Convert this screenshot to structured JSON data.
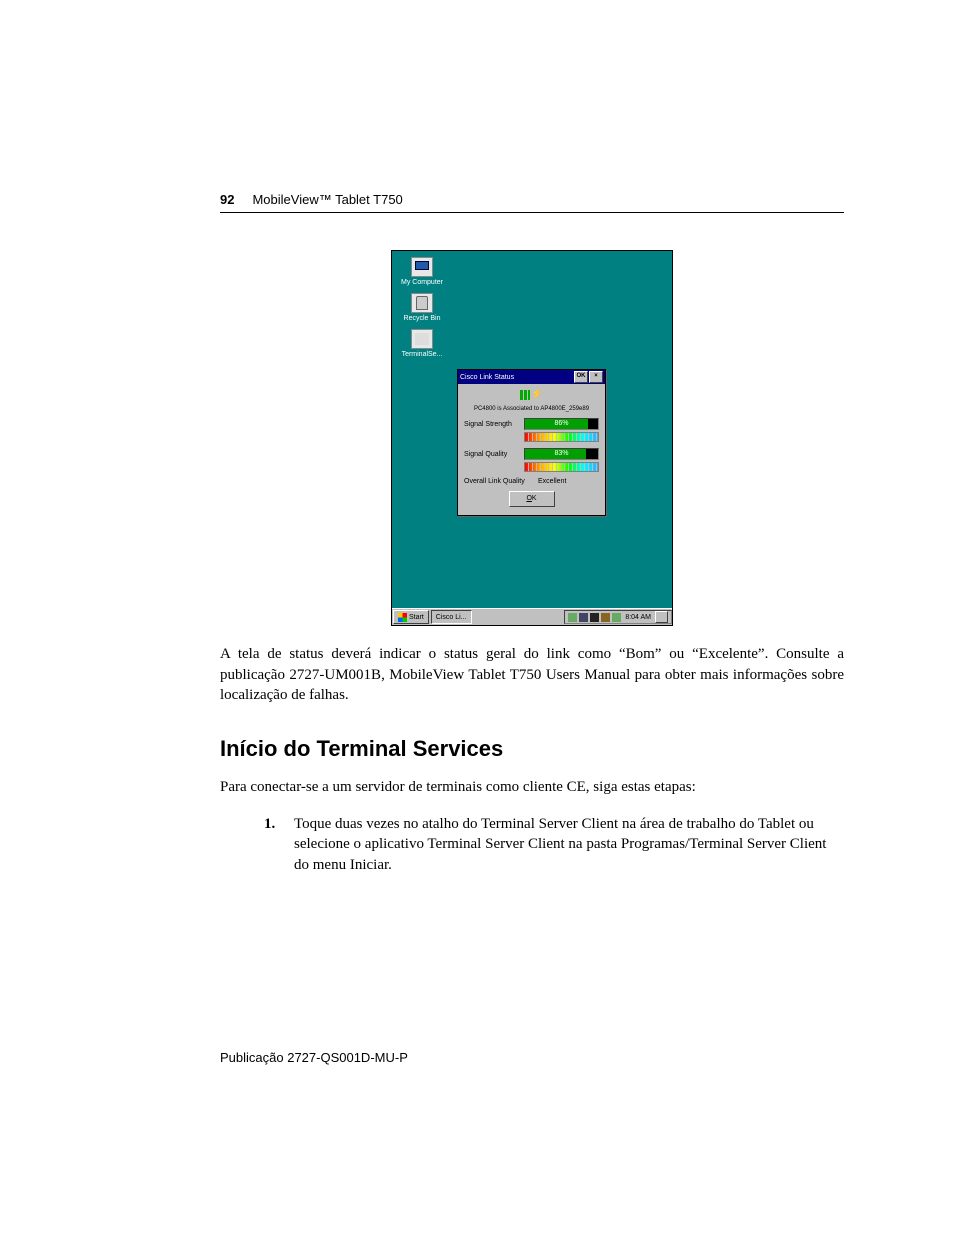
{
  "header": {
    "page_number": "92",
    "title": "MobileView™ Tablet T750"
  },
  "screenshot": {
    "desktop_icons": {
      "my_computer": "My Computer",
      "recycle_bin": "Recycle Bin",
      "terminal": "TerminalSe..."
    },
    "dialog": {
      "title": "Cisco Link Status",
      "ok_caption": "OK",
      "close_caption": "×",
      "association": "PC4800 is Associated to AP4800E_259e89",
      "signal_strength_label": "Signal Strength",
      "signal_strength_value": "86%",
      "signal_strength_fill": 86,
      "signal_quality_label": "Signal Quality",
      "signal_quality_value": "83%",
      "signal_quality_fill": 83,
      "overall_label": "Overall Link Quality",
      "overall_value": "Excellent",
      "ok_button_prefix": "O",
      "ok_button_suffix": "K"
    },
    "taskbar": {
      "start": "Start",
      "task1": "Cisco Li...",
      "clock": "8:04 AM"
    }
  },
  "caption_paragraph": "A tela de status deverá indicar o status geral do link como “Bom” ou “Excelente”. Consulte a publicação 2727-UM001B, MobileView Tablet T750 Users Manual para obter mais informações sobre localização de falhas.",
  "section_heading": "Início do Terminal Services",
  "intro_paragraph": "Para conectar-se a um servidor de terminais como cliente CE, siga estas etapas:",
  "step1_number": "1.",
  "step1_text": "Toque duas vezes no atalho do Terminal Server Client na área de trabalho do Tablet ou selecione o aplicativo Terminal Server Client na pasta Programas/Terminal Server Client do menu Iniciar.",
  "footer": "Publicação 2727-QS001D-MU-P"
}
